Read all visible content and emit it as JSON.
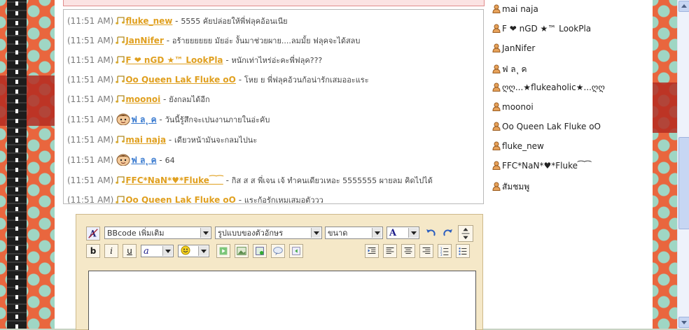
{
  "colors": {
    "accent": "#e0a020",
    "link_blue": "#3a7bd0",
    "bg_orange": "#e9663e",
    "dot": "#9fd6c4"
  },
  "chat": {
    "messages": [
      {
        "time": "(11:51 AM)",
        "user": "fluke_new",
        "msg": "5555 คัยปล่อยให้พี่ฟลุคอ้อนเนีย",
        "user_color": "accent",
        "icon": "music-note-icon"
      },
      {
        "time": "(11:51 AM)",
        "user": "JanNifer",
        "msg": "อร้ายยยยยย มัยอ่ะ งั้นมาช่วยผาย....ลมมั้ย ฟลุคจะได้สลบ",
        "user_color": "accent",
        "icon": "music-note-icon"
      },
      {
        "time": "(11:51 AM)",
        "user": "F ❤ nGD ★™ LookPla",
        "msg": "หนักเท่าไหร่อ่ะคะพี่ฟลุค???",
        "user_color": "accent",
        "icon": "music-note-icon"
      },
      {
        "time": "(11:51 AM)",
        "user": "Oo Queen Lak Fluke oO",
        "msg": "โหย ย พี่ฟลุคอ้วนก้อน่ารักเสมออะแระ",
        "user_color": "accent",
        "icon": "music-note-icon"
      },
      {
        "time": "(11:51 AM)",
        "user": "moonoi",
        "msg": "ยังกลมได้อีก",
        "user_color": "accent",
        "icon": "music-note-icon"
      },
      {
        "time": "(11:51 AM)",
        "user": "ฟ ล ุ ค",
        "msg": "วันนี้รู้สึกจะเปนงานภายในอ่ะคับ",
        "user_color": "blue",
        "icon": "smiley-avatar-icon"
      },
      {
        "time": "(11:51 AM)",
        "user": "mai naja",
        "msg": "เดียวหน้ามันจะกลมไปนะ",
        "user_color": "accent",
        "icon": "music-note-icon"
      },
      {
        "time": "(11:51 AM)",
        "user": "ฟ ล ุ ค",
        "msg": "64",
        "user_color": "blue",
        "icon": "smiley-avatar-icon"
      },
      {
        "time": "(11:51 AM)",
        "user": "FFC*NaN*♥*Fluke⁀⁀",
        "msg": "กิส ส ส พี่เจน เจ้ ทำคนเดียวเหอะ 5555555 ผายลม คิดไปได้",
        "user_color": "accent",
        "icon": "music-note-icon"
      },
      {
        "time": "(11:51 AM)",
        "user": "Oo Queen Lak Fluke oO",
        "msg": "แระก้อรักเหมเสมอตัววว",
        "user_color": "accent",
        "icon": "music-note-icon"
      }
    ]
  },
  "editor": {
    "bbcode_select": "BBcode เพิ่มเติม",
    "font_select": "รูปแบบของตัวอักษร",
    "size_select": "ขนาด",
    "color_btn": "A",
    "bold": "b",
    "italic": "i",
    "underline": "u",
    "text_content": ""
  },
  "users": [
    "mai naja",
    "F ❤ nGD ★™ LookPla",
    "JanNifer",
    "ฟ ล ุ ค",
    "ღღ...★flukeaholic★...ღღ",
    "moonoi",
    "Oo Queen Lak Fluke oO",
    "fluke_new",
    "FFC*NaN*♥*Fluke⁀⁀",
    "สัมชมพู"
  ]
}
